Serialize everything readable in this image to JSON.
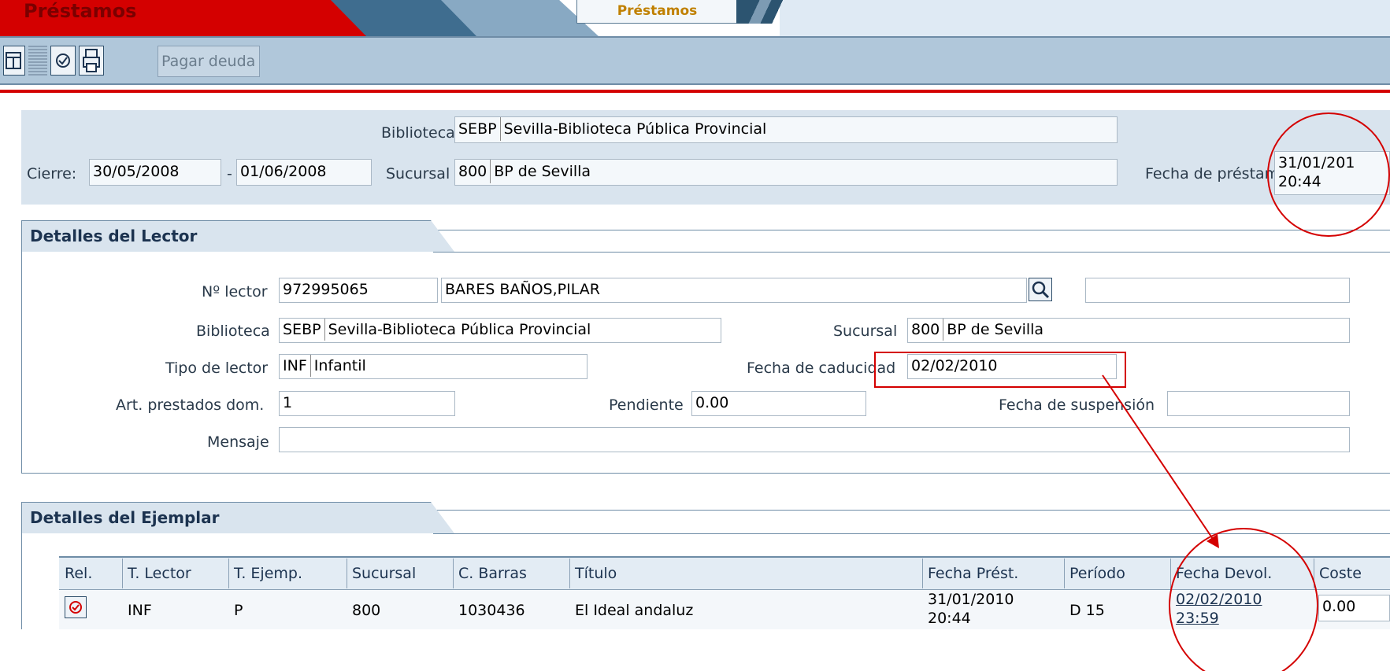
{
  "app": {
    "title": "Préstamos",
    "tab": "Préstamos"
  },
  "toolbar": {
    "pay_label": "Pagar deuda"
  },
  "header": {
    "cierre_label": "Cierre:",
    "cierre_from": "30/05/2008",
    "cierre_sep": "-",
    "cierre_to": "01/06/2008",
    "biblioteca_label": "Biblioteca",
    "biblioteca_code": "SEBP",
    "biblioteca_name": "Sevilla-Biblioteca Pública Provincial",
    "sucursal_label": "Sucursal",
    "sucursal_code": "800",
    "sucursal_name": "BP de Sevilla",
    "fecha_prestamo_label": "Fecha de préstamo",
    "fecha_prestamo_date": "31/01/201",
    "fecha_prestamo_time": "20:44"
  },
  "reader": {
    "section_title": "Detalles del Lector",
    "numero_label": "Nº lector",
    "numero": "972995065",
    "nombre": "BARES BAÑOS,PILAR",
    "biblioteca_label": "Biblioteca",
    "biblioteca_code": "SEBP",
    "biblioteca_name": "Sevilla-Biblioteca Pública Provincial",
    "sucursal_label": "Sucursal",
    "sucursal_code": "800",
    "sucursal_name": "BP de Sevilla",
    "tipo_label": "Tipo de lector",
    "tipo_code": "INF",
    "tipo_name": "Infantil",
    "caducidad_label": "Fecha de caducidad",
    "caducidad": "02/02/2010",
    "prestados_label": "Art. prestados dom.",
    "prestados": "1",
    "pendiente_label": "Pendiente",
    "pendiente": "0.00",
    "suspension_label": "Fecha de suspensión",
    "suspension": "",
    "mensaje_label": "Mensaje",
    "mensaje": ""
  },
  "items": {
    "section_title": "Detalles del Ejemplar",
    "columns": [
      "Rel.",
      "T. Lector",
      "T. Ejemp.",
      "Sucursal",
      "C. Barras",
      "Título",
      "Fecha Prést.",
      "Período",
      "Fecha Devol.",
      "Coste"
    ],
    "rows": [
      {
        "t_lector": "INF",
        "t_ejemp": "P",
        "sucursal": "800",
        "c_barras": "1030436",
        "titulo": "El Ideal andaluz",
        "fecha_prest_date": "31/01/2010",
        "fecha_prest_time": "20:44",
        "periodo": "D 15",
        "fecha_devol_date": "02/02/2010",
        "fecha_devol_time": "23:59",
        "coste": "0.00"
      }
    ]
  },
  "colors": {
    "accent_red": "#d40000",
    "panel_blue": "#d9e4ee",
    "header_blue": "#3f6d8f"
  }
}
